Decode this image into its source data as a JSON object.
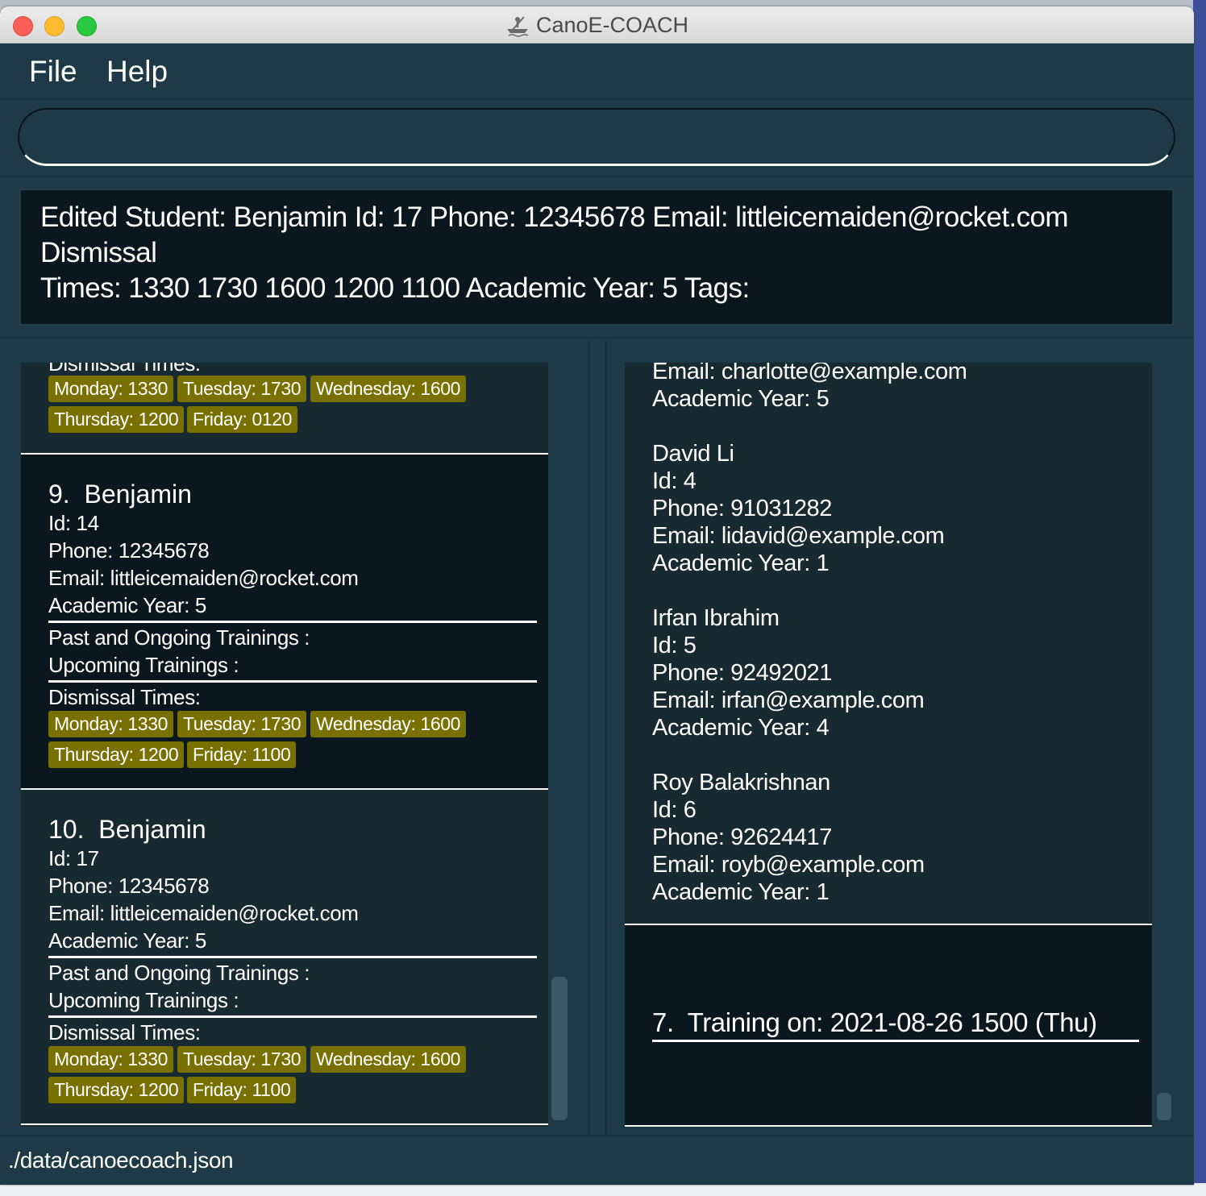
{
  "window": {
    "title": "CanoE-COACH"
  },
  "menu": {
    "file": "File",
    "help": "Help"
  },
  "command": {
    "value": "",
    "placeholder": ""
  },
  "result": {
    "line1": "Edited Student: Benjamin Id: 17 Phone: 12345678 Email: littleicemaiden@rocket.com Dismissal",
    "line2": "Times: 1330 1730 1600 1200 1100  Academic  Year: 5 Tags:"
  },
  "students": {
    "partial": {
      "dismissal_label": "Dismissal Times:",
      "tags": [
        "Monday: 1330",
        "Tuesday: 1730",
        "Wednesday: 1600",
        "Thursday: 1200",
        "Friday: 0120"
      ]
    },
    "cards": [
      {
        "index": "9.",
        "name": "Benjamin",
        "id": "Id: 14",
        "phone": "Phone: 12345678",
        "email": "Email: littleicemaiden@rocket.com",
        "year": "Academic Year: 5",
        "past": "Past and Ongoing Trainings :",
        "upcoming": "Upcoming Trainings :",
        "dismissal_label": "Dismissal Times:",
        "tags": [
          "Monday: 1330",
          "Tuesday: 1730",
          "Wednesday: 1600",
          "Thursday: 1200",
          "Friday: 1100"
        ]
      },
      {
        "index": "10.",
        "name": "Benjamin",
        "id": "Id: 17",
        "phone": "Phone: 12345678",
        "email": "Email: littleicemaiden@rocket.com",
        "year": "Academic Year: 5",
        "past": "Past and Ongoing Trainings :",
        "upcoming": "Upcoming Trainings :",
        "dismissal_label": "Dismissal Times:",
        "tags": [
          "Monday: 1330",
          "Tuesday: 1730",
          "Wednesday: 1600",
          "Thursday: 1200",
          "Friday: 1100"
        ]
      }
    ]
  },
  "trainings": {
    "partial_student": {
      "email": "Email: charlotte@example.com",
      "year": "Academic  Year: 5"
    },
    "students": [
      {
        "name": "David Li",
        "id": "Id: 4",
        "phone": "Phone: 91031282",
        "email": "Email: lidavid@example.com",
        "year": "Academic  Year: 1"
      },
      {
        "name": "Irfan Ibrahim",
        "id": "Id: 5",
        "phone": "Phone: 92492021",
        "email": "Email: irfan@example.com",
        "year": "Academic  Year: 4"
      },
      {
        "name": "Roy Balakrishnan",
        "id": "Id: 6",
        "phone": "Phone: 92624417",
        "email": "Email: royb@example.com",
        "year": "Academic  Year: 1"
      }
    ],
    "next": {
      "index": "7.",
      "label": "Training on: 2021-08-26 1500 (Thu)"
    }
  },
  "status": {
    "path": "./data/canoecoach.json"
  },
  "colors": {
    "window_bg": "#1d3a46",
    "card_dark": "#0b171e",
    "tag_bg": "#787000",
    "text": "#ffffff"
  }
}
